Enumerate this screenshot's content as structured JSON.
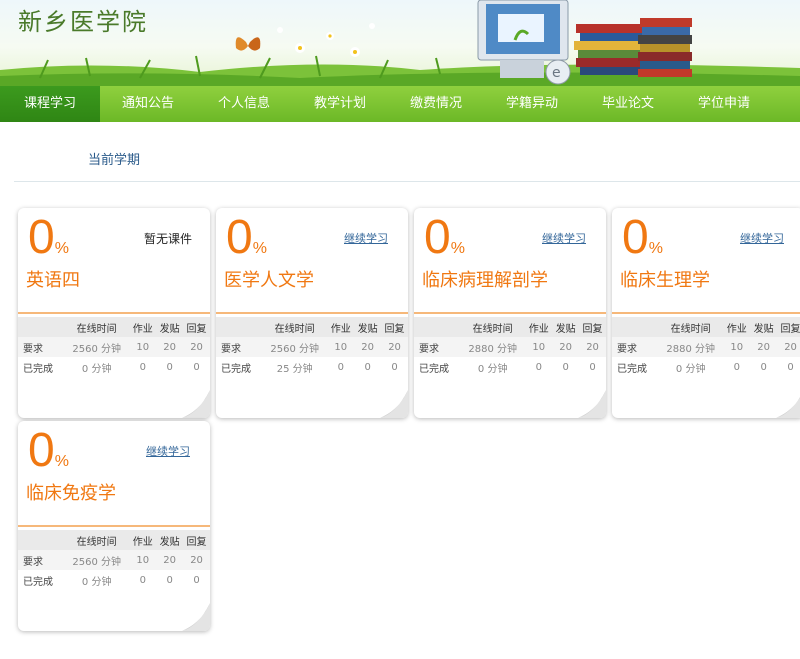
{
  "site": {
    "title": "新乡医学院"
  },
  "nav": [
    {
      "label": "课程学习",
      "active": true
    },
    {
      "label": "通知公告"
    },
    {
      "label": "个人信息"
    },
    {
      "label": "教学计划"
    },
    {
      "label": "缴费情况"
    },
    {
      "label": "学籍异动"
    },
    {
      "label": "毕业论文"
    },
    {
      "label": "学位申请"
    }
  ],
  "semester_label": "当前学期",
  "table_headers": [
    "",
    "在线时间",
    "作业",
    "发贴",
    "回复"
  ],
  "row_labels": {
    "required": "要求",
    "completed": "已完成"
  },
  "colors": {
    "accent": "#f07812",
    "nav_green": "#6cb827",
    "nav_active": "#2f8614",
    "link": "#336699"
  },
  "courses": [
    {
      "percent": "0",
      "percent_symbol": "%",
      "name": "英语四",
      "action": "暂无课件",
      "action_is_link": false,
      "required": [
        "2560 分钟",
        "10",
        "20",
        "20"
      ],
      "completed": [
        "0 分钟",
        "0",
        "0",
        "0"
      ]
    },
    {
      "percent": "0",
      "percent_symbol": "%",
      "name": "医学人文学",
      "action": "继续学习",
      "action_is_link": true,
      "required": [
        "2560 分钟",
        "10",
        "20",
        "20"
      ],
      "completed": [
        "25 分钟",
        "0",
        "0",
        "0"
      ]
    },
    {
      "percent": "0",
      "percent_symbol": "%",
      "name": "临床病理解剖学",
      "action": "继续学习",
      "action_is_link": true,
      "required": [
        "2880 分钟",
        "10",
        "20",
        "20"
      ],
      "completed": [
        "0 分钟",
        "0",
        "0",
        "0"
      ]
    },
    {
      "percent": "0",
      "percent_symbol": "%",
      "name": "临床生理学",
      "action": "继续学习",
      "action_is_link": true,
      "required": [
        "2880 分钟",
        "10",
        "20",
        "20"
      ],
      "completed": [
        "0 分钟",
        "0",
        "0",
        "0"
      ]
    },
    {
      "percent": "0",
      "percent_symbol": "%",
      "name": "临床免疫学",
      "action": "继续学习",
      "action_is_link": true,
      "required": [
        "2560 分钟",
        "10",
        "20",
        "20"
      ],
      "completed": [
        "0 分钟",
        "0",
        "0",
        "0"
      ]
    }
  ]
}
